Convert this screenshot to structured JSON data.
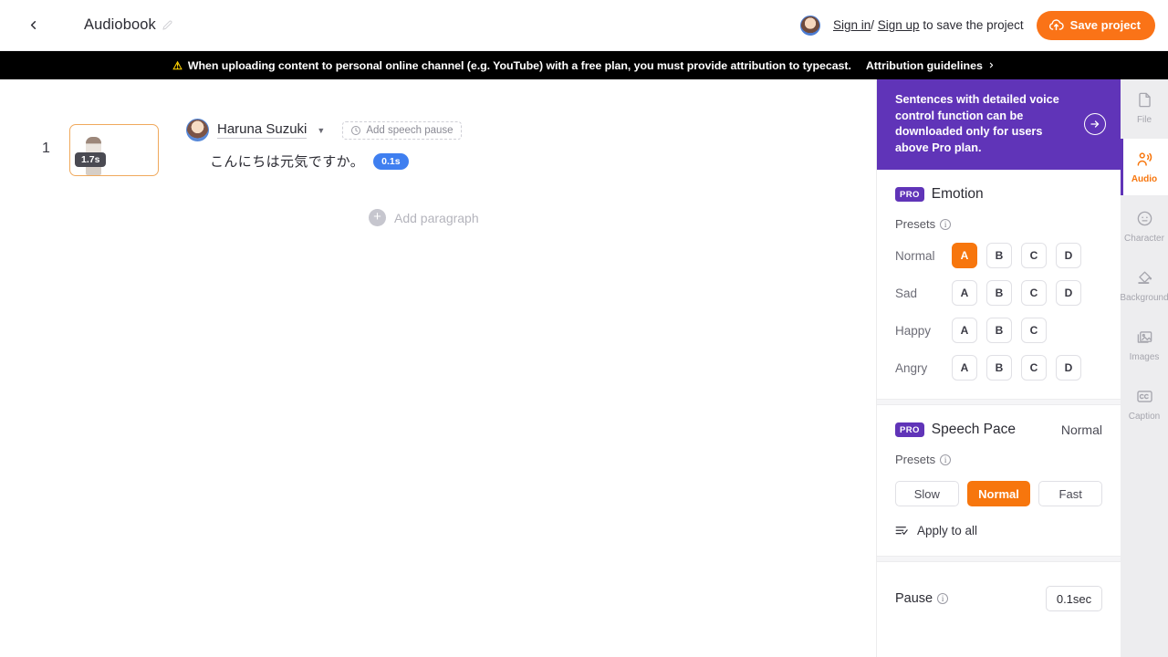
{
  "topbar": {
    "back_icon": "chevron-left-icon",
    "project_title": "Audiobook",
    "edit_icon": "pencil-icon",
    "signin_label": "Sign in",
    "divider": "/",
    "signup_label": "Sign up",
    "signin_suffix": "to save the project",
    "save_label": "Save project",
    "save_icon": "cloud-upload-icon"
  },
  "notice": {
    "warn_icon": "warning-triangle-icon",
    "message": "When uploading content to personal online channel (e.g. YouTube) with a free plan, you must provide attribution to typecast.",
    "link_label": "Attribution guidelines",
    "link_chevron": "chevron-right-icon"
  },
  "editor": {
    "paragraphs": [
      {
        "number": "1",
        "duration_badge": "1.7s",
        "speaker": "Haruna Suzuki",
        "speaker_caret": "chevron-down-icon",
        "add_pause_label": "Add speech pause",
        "add_pause_icon": "clock-icon",
        "sentence": "こんにちは元気ですか。",
        "pause_chip": "0.1s"
      }
    ],
    "add_paragraph_label": "Add paragraph",
    "add_paragraph_icon": "plus-circle-icon"
  },
  "right_panel": {
    "promo": {
      "text": "Sentences with detailed voice control function can be downloaded only for users above Pro plan.",
      "arrow_icon": "arrow-right-circle-icon",
      "bg_color": "#6034b8"
    },
    "emotion": {
      "pro_badge": "PRO",
      "title": "Emotion",
      "presets_label": "Presets",
      "info_icon": "info-icon",
      "rows": [
        {
          "name": "Normal",
          "options": [
            "A",
            "B",
            "C",
            "D"
          ],
          "selected": "A"
        },
        {
          "name": "Sad",
          "options": [
            "A",
            "B",
            "C",
            "D"
          ],
          "selected": null
        },
        {
          "name": "Happy",
          "options": [
            "A",
            "B",
            "C"
          ],
          "selected": null
        },
        {
          "name": "Angry",
          "options": [
            "A",
            "B",
            "C",
            "D"
          ],
          "selected": null
        }
      ]
    },
    "speech_pace": {
      "pro_badge": "PRO",
      "title": "Speech Pace",
      "value": "Normal",
      "presets_label": "Presets",
      "info_icon": "info-icon",
      "options": [
        "Slow",
        "Normal",
        "Fast"
      ],
      "selected": "Normal",
      "apply_all_label": "Apply to all",
      "apply_all_icon": "apply-all-icon"
    },
    "pause": {
      "label": "Pause",
      "info_icon": "info-icon",
      "value": "0.1sec"
    }
  },
  "rail": {
    "items": [
      {
        "label": "File",
        "icon": "file-icon",
        "selected": false
      },
      {
        "label": "Audio",
        "icon": "audio-person-icon",
        "selected": true
      },
      {
        "label": "Character",
        "icon": "character-face-icon",
        "selected": false
      },
      {
        "label": "Background",
        "icon": "paint-bucket-icon",
        "selected": false
      },
      {
        "label": "Images",
        "icon": "images-icon",
        "selected": false
      },
      {
        "label": "Caption",
        "icon": "caption-cc-icon",
        "selected": false
      }
    ]
  },
  "colors": {
    "accent_orange": "#F7760D",
    "brand_purple": "#6034b8",
    "pause_blue": "#3f7ff0",
    "warning_yellow": "#ffd200"
  }
}
